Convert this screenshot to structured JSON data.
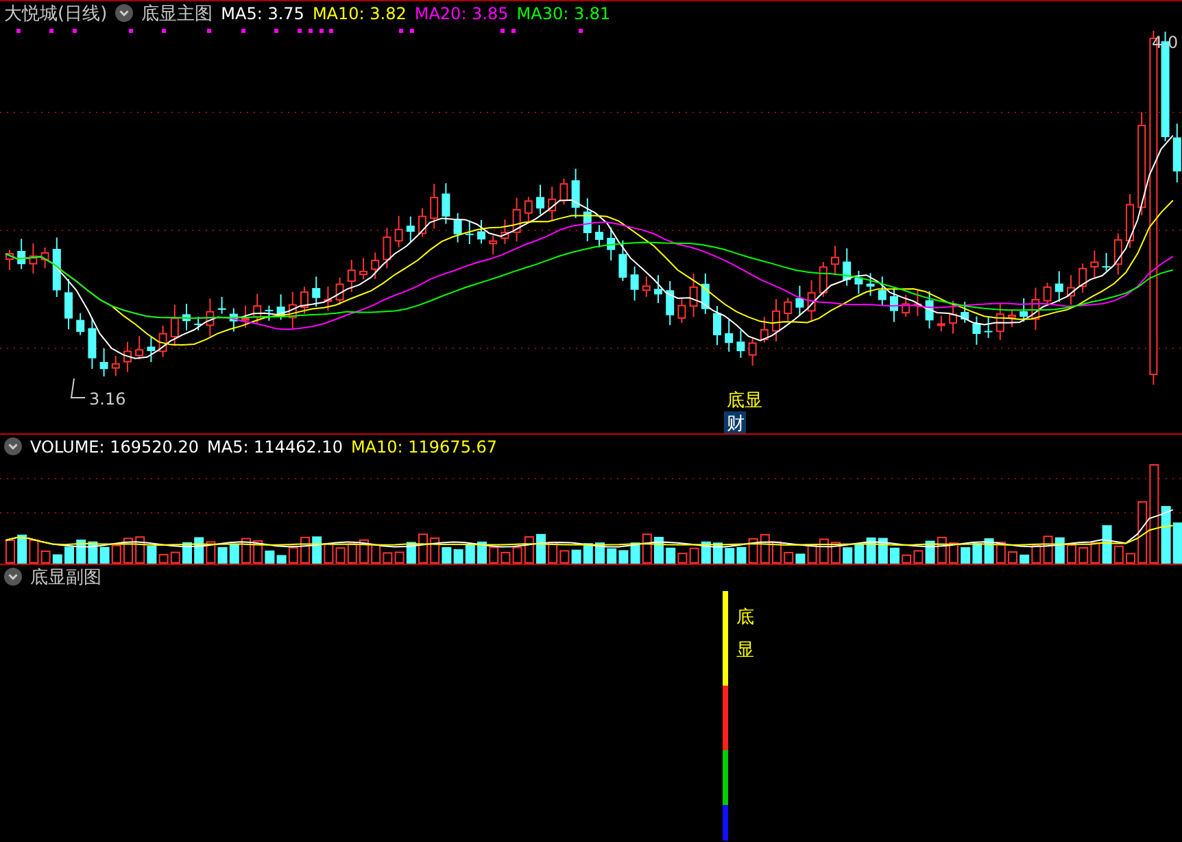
{
  "main_panel": {
    "stock_name": "大悦城(日线)",
    "indicator": "底显主图",
    "ma_readings": [
      {
        "label": "MA5: 3.75",
        "color": "#ffffff"
      },
      {
        "label": "MA10: 3.82",
        "color": "#ffff00"
      },
      {
        "label": "MA20: 3.85",
        "color": "#ff00ff"
      },
      {
        "label": "MA30: 3.81",
        "color": "#00ff00"
      }
    ],
    "low_label": "3.16",
    "high_label": "4.0",
    "signal_label": "底显",
    "badge": "财"
  },
  "volume_panel": {
    "readings": [
      {
        "label": "VOLUME: 169520.20",
        "color": "#ffffff"
      },
      {
        "label": "MA5: 114462.10",
        "color": "#ffffff"
      },
      {
        "label": "MA10: 119675.67",
        "color": "#ffff00"
      }
    ]
  },
  "sub_panel": {
    "title": "底显副图",
    "signal_chars": [
      "底",
      "显"
    ]
  }
}
